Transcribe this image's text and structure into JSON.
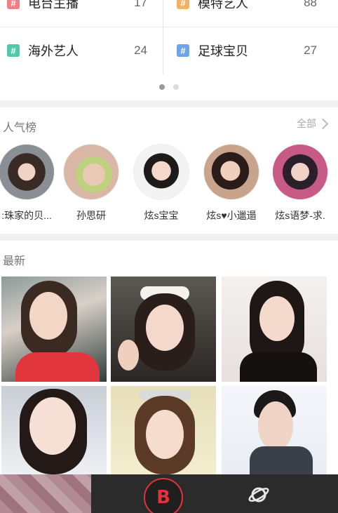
{
  "categories": [
    {
      "name": "电台主播",
      "count": "17",
      "color": "#f07f86"
    },
    {
      "name": "模特艺人",
      "count": "88",
      "color": "#f5b163"
    },
    {
      "name": "海外艺人",
      "count": "24",
      "color": "#4fc9a7"
    },
    {
      "name": "足球宝贝",
      "count": "27",
      "color": "#6ba5e8"
    }
  ],
  "popular": {
    "title": "人气榜",
    "see_all": "全部",
    "items": [
      {
        "name": ":珠家的贝..."
      },
      {
        "name": "孙思研"
      },
      {
        "name": "炫s宝宝"
      },
      {
        "name": "炫s♥小邋遢"
      },
      {
        "name": "炫s语梦-求."
      }
    ]
  },
  "latest": {
    "title": "最新"
  },
  "tabbar": {
    "center_label": "B",
    "accent": "#e2323a"
  }
}
